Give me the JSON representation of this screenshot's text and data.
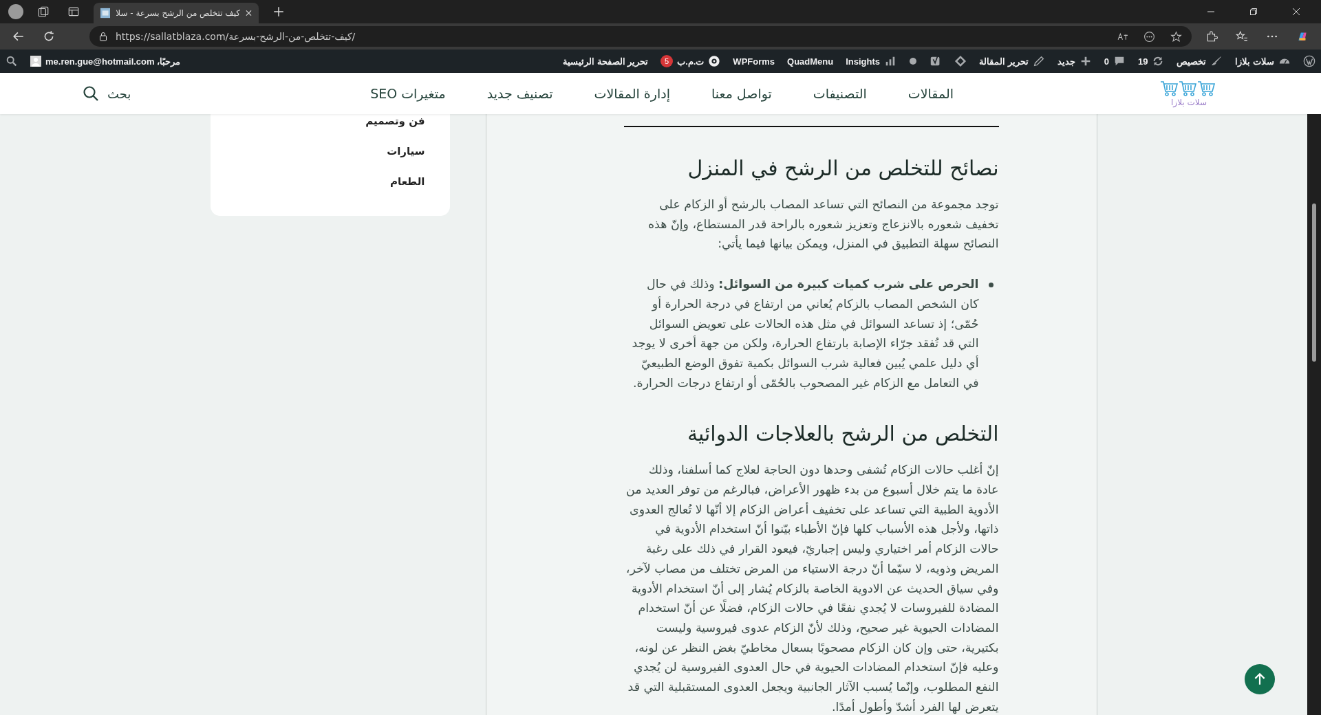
{
  "browser": {
    "tabs": [
      {
        "title": "كيف تتخلص من الرشح بسرعة - سلا",
        "selected": true
      }
    ],
    "url": "https://sallatblaza.com/كيف-تتخلص-من-الرشح-بسرعة/"
  },
  "admin_bar": {
    "items": [
      {
        "kind": "wordpress"
      },
      {
        "kind": "site",
        "label": "سلات بلازا"
      },
      {
        "kind": "customize",
        "label": "تخصيص"
      },
      {
        "kind": "updates",
        "label": "19"
      },
      {
        "kind": "comments",
        "label": "0"
      },
      {
        "kind": "new",
        "label": "جديد"
      },
      {
        "kind": "edit",
        "label": "تحرير المقالة"
      },
      {
        "kind": "diamond"
      },
      {
        "kind": "yoast"
      },
      {
        "kind": "dot"
      },
      {
        "kind": "insights",
        "label": "Insights"
      },
      {
        "kind": "text",
        "label": "QuadMenu"
      },
      {
        "kind": "text",
        "label": "WPForms"
      },
      {
        "kind": "gear",
        "label": "ت.م.ب",
        "badge": "5"
      },
      {
        "kind": "text",
        "label": "تحرير الصفحة الرئيسية"
      }
    ],
    "account": "مرحبًا، me.ren.gue@hotmail.com"
  },
  "nav": {
    "logo_text": "سلات بلازا",
    "items": [
      "المقالات",
      "التصنيفات",
      "تواصل معنا",
      "إدارة المقالات",
      "تصنيف جديد",
      "متغيرات SEO"
    ],
    "search_label": "بحث"
  },
  "sidebar": {
    "items": [
      "فن وتصميم",
      "سيارات",
      "الطعام"
    ]
  },
  "article": {
    "blocks": [
      {
        "kind": "heading",
        "text": "نصائح للتخلص من الرشح في المنزل"
      },
      {
        "kind": "paragraph",
        "text": "توجد مجموعة من النصائح التي تساعد المصاب بالرشح أو الزكام على تخفيف شعوره بالانزعاج وتعزيز شعوره بالراحة قدر المستطاع، وإنّ هذه النصائح سهلة التطبيق في المنزل، ويمكن بيانها فيما يأتي:"
      },
      {
        "kind": "list",
        "items": [
          "**الحرص على شرب كميات كبيرة من السوائل:** وذلك في حال كان الشخص المصاب بالزكام يُعاني من ارتفاع في درجة الحرارة أو حُمّى؛ إذ تساعد السوائل في مثل هذه الحالات على تعويض السوائل التي قد تُفقد جرّاء الإصابة بارتفاع الحرارة، ولكن من جهة أخرى لا يوجد أي دليل علمي يُبين فعالية شرب السوائل بكمية تفوق الوضع الطبيعيّ في التعامل مع الزكام غير المصحوب بالحُمّى أو ارتفاع درجات الحرارة."
        ]
      },
      {
        "kind": "heading",
        "text": "التخلص من الرشح بالعلاجات الدوائية"
      },
      {
        "kind": "paragraph",
        "text": "إنّ أغلب حالات الزكام تُشفى وحدها دون الحاجة لعلاج كما أسلفنا، وذلك عادة ما يتم خلال أسبوع من بدء ظهور الأعراض، فبالرغم من توفر العديد من الأدوية الطبية التي تساعد على تخفيف أعراض الزكام إلا أنّها لا تُعالج العدوى ذاتها، ولأجل هذه الأسباب كلها فإنّ الأطباء بيّنوا أنّ استخدام الأدوية في حالات الزكام أمر اختياري وليس إجباريّ، فيعود القرار في ذلك على رغبة المريض وذويه، لا سيّما أنّ درجة الاستياء من المرض تختلف من مصاب لآخر، وفي سياق الحديث عن الادوية الخاصة بالزكام يُشار إلى أنّ استخدام الأدوية المضادة للفيروسات لا يُجدي نفعًا في حالات الزكام، فضلًا عن أنّ استخدام المضادات الحيوية غير صحيح، وذلك لأنّ الزكام عدوى فيروسية وليست بكتيرية، حتى وإن كان الزكام مصحوبًا بسعال مخاطيّ بغض النظر عن لونه، وعليه فإنّ استخدام المضادات الحيوية في حال العدوى الفيروسية لن يُجدي النفع المطلوب، وإنّما يُسبب الآثار الجانبية ويجعل العدوى المستقبلية التي قد يتعرض لها الفرد أشدّ وأطول أمدًا."
      }
    ]
  }
}
